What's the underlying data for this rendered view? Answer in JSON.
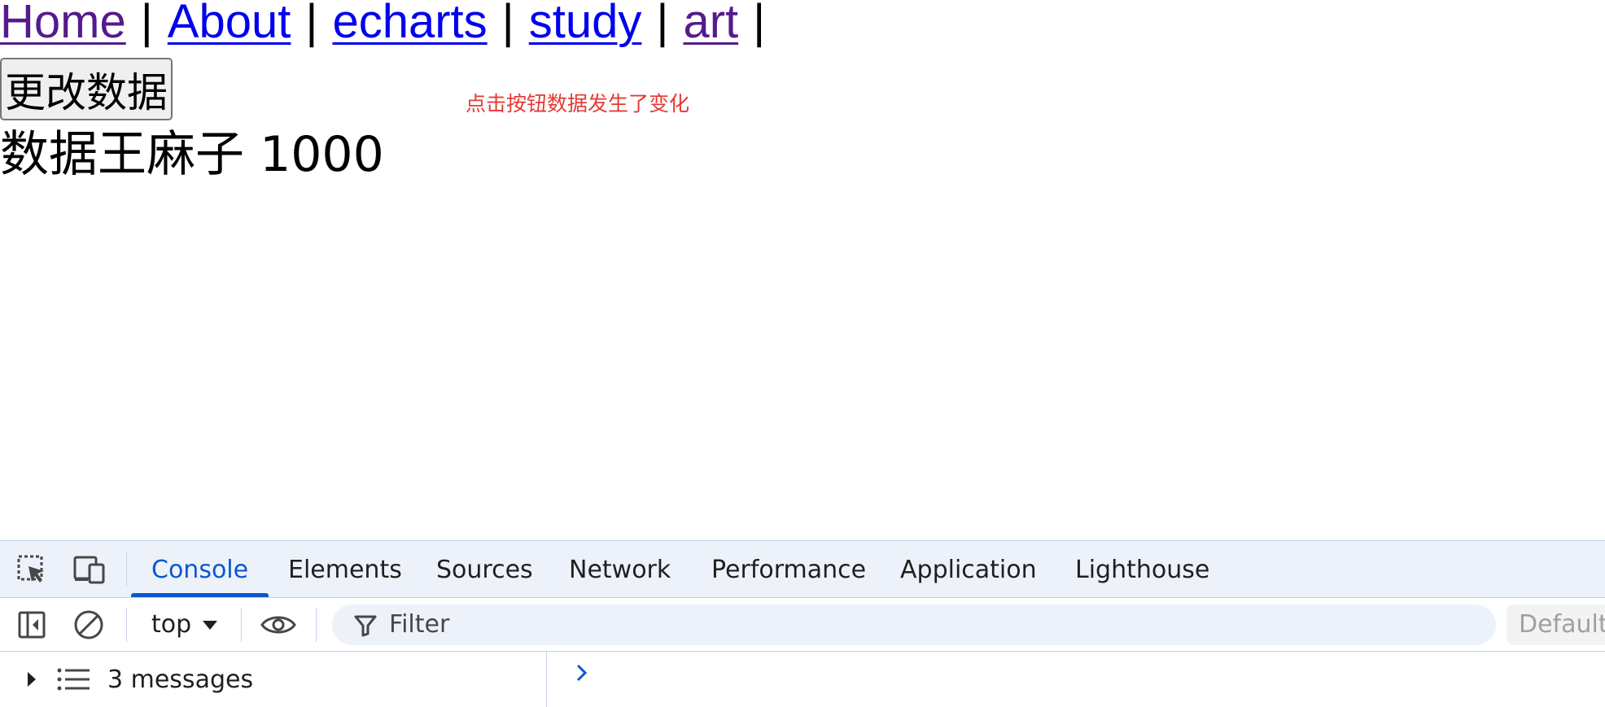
{
  "nav": {
    "links": [
      {
        "label": "Home",
        "visited": true
      },
      {
        "label": "About",
        "visited": false
      },
      {
        "label": "echarts",
        "visited": false
      },
      {
        "label": "study",
        "visited": false
      },
      {
        "label": "art",
        "visited": true
      }
    ],
    "separator": "|"
  },
  "content": {
    "button_label": "更改数据",
    "hint_text": "点击按钮数据发生了变化",
    "data_text": "数据王麻子 1000"
  },
  "devtools": {
    "tabs": [
      "Console",
      "Elements",
      "Sources",
      "Network",
      "Performance",
      "Application",
      "Lighthouse"
    ],
    "active_tab": "Console",
    "context": "top",
    "filter_placeholder": "Filter",
    "levels_label": "Default",
    "sidebar_messages": "3 messages",
    "accent_color": "#0b57d0",
    "icons": [
      "select-element-icon",
      "device-toolbar-icon",
      "sidebar-toggle-icon",
      "clear-console-icon",
      "live-expression-eye-icon",
      "filter-funnel-icon",
      "list-icon",
      "prompt-chevron-icon"
    ]
  },
  "colors": {
    "visited_link": "#551a8b",
    "link": "#0000ee",
    "hint": "#e53935"
  }
}
